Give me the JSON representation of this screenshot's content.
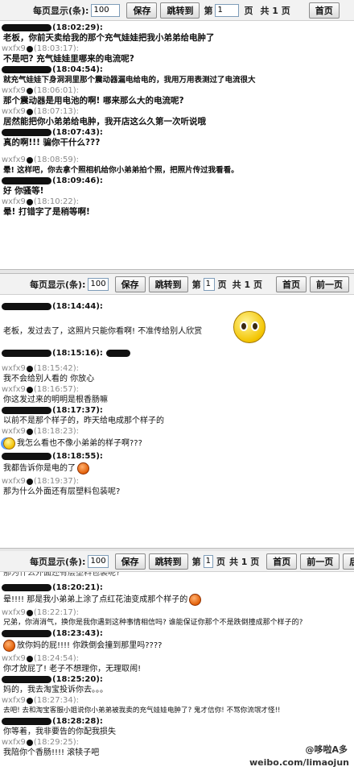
{
  "toolbar": {
    "per_page_label": "每页显示(条):",
    "per_page_value": "100",
    "save_label": "保存",
    "jump_label": "跳转到",
    "page_prefix": "第",
    "page_value": "1",
    "page_suffix": "页",
    "total_label": "共 1 页",
    "first_label": "首页",
    "prev_label": "前一页",
    "next_label": "后一"
  },
  "panel1": {
    "messages": [
      {
        "sender_prefix": "",
        "time": "(18:02:29):",
        "text": "老板，你前天卖给我的那个充气娃娃把我小弟弟给电肿了"
      },
      {
        "sender_prefix": "wxfx9",
        "time": "(18:03:17):",
        "text": "不是吧? 充气娃娃里哪来的电流呢?"
      },
      {
        "sender_prefix": "",
        "time": "(18:04:54):",
        "text": "就充气娃娃下身洞洞里那个震动器漏电给电的，我用万用表测过了电流很大"
      },
      {
        "sender_prefix": "wxfx9",
        "time": "(18:06:01):",
        "text": "那个震动器是用电池的啊! 哪来那么大的电流呢?"
      },
      {
        "sender_prefix": "wxfx9",
        "time": "(18:07:13):",
        "text": "居然能把你小弟弟给电肿，我开店这么久第一次听说哦"
      },
      {
        "sender_prefix": "",
        "time": "(18:07:43):",
        "text": "真的啊!!! 骗你干什么???"
      },
      {
        "sender_prefix": "wxfx9",
        "time": "(18:08:59):",
        "text": "晕!  这样吧，你去拿个照相机给你小弟弟拍个照，把照片传过我看看。"
      },
      {
        "sender_prefix": "",
        "time": "(18:09:46):",
        "text": "好  你骚等!"
      },
      {
        "sender_prefix": "wxfx9",
        "time": "(18:10:22):",
        "text": "晕!  打错字了是稍等啊!"
      }
    ]
  },
  "panel2": {
    "messages": [
      {
        "sender_prefix": "",
        "time": "(18:14:44):",
        "text": "老板，发过去了，这照片只能你看啊! 不准传给别人欣赏"
      },
      {
        "sender_prefix": "",
        "time": "(18:15:16):",
        "text": ""
      },
      {
        "sender_prefix": "wxfx9",
        "time": "(18:15:42):",
        "text": "我不会给别人看的  你放心"
      },
      {
        "sender_prefix": "wxfx9",
        "time": "(18:16:57):",
        "text": "你这发过来的明明是根香肠嘛"
      },
      {
        "sender_prefix": "",
        "time": "(18:17:37):",
        "text": "以前不是那个样子的，昨天给电成那个样子的"
      },
      {
        "sender_prefix": "wxfx9",
        "time": "(18:18:23):",
        "text": "我怎么看也不像小弟弟的样子啊???"
      },
      {
        "sender_prefix": "",
        "time": "(18:18:55):",
        "text": "我都告诉你是电的了"
      },
      {
        "sender_prefix": "wxfx9",
        "time": "(18:19:37):",
        "text": "那为什么外面还有层塑料包装呢?"
      }
    ]
  },
  "panel3": {
    "top_cut_text": "那为什么外面还有层塑料包装呢?",
    "messages": [
      {
        "sender_prefix": "",
        "time": "(18:20:21):",
        "text": "晕!!!!  那是我小弟弟上涂了点红花油变成那个样子的"
      },
      {
        "sender_prefix": "wxfx9",
        "time": "(18:22:17):",
        "text": "兄弟，你消消气，换你是我你遇到这种事情相信吗? 谁能保证你那个不是跌倒撞成那个样子的?"
      },
      {
        "sender_prefix": "",
        "time": "(18:23:43):",
        "text": "放你妈的屁!!!! 你跌倒会撞到那里吗????"
      },
      {
        "sender_prefix": "wxfx9",
        "time": "(18:24:54):",
        "text": "你才放屁了! 老子不想理你，无理取闹!"
      },
      {
        "sender_prefix": "",
        "time": "(18:25:20):",
        "text": "妈的，我去淘宝投诉你去。。。"
      },
      {
        "sender_prefix": "wxfx9",
        "time": "(18:27:34):",
        "text": "去吧! 去和淘宝客服小姐说你小弟弟被我卖的充气娃娃电肿了? 鬼才信你! 不骂你流氓才怪!!"
      },
      {
        "sender_prefix": "",
        "time": "(18:28:28):",
        "text": "你等着，我非要告的你配我损失"
      },
      {
        "sender_prefix": "wxfx9",
        "time": "(18:29:25):",
        "text": "我陪你个香肠!!!! 滚犊子吧"
      }
    ]
  },
  "watermark": {
    "line1": "@哆啦A多",
    "line2": "weibo.com/limaojun"
  },
  "colors": {
    "toolbar_bg": "#f2f2f2",
    "grey_sender": "#8a8a8a",
    "text": "#111111"
  }
}
